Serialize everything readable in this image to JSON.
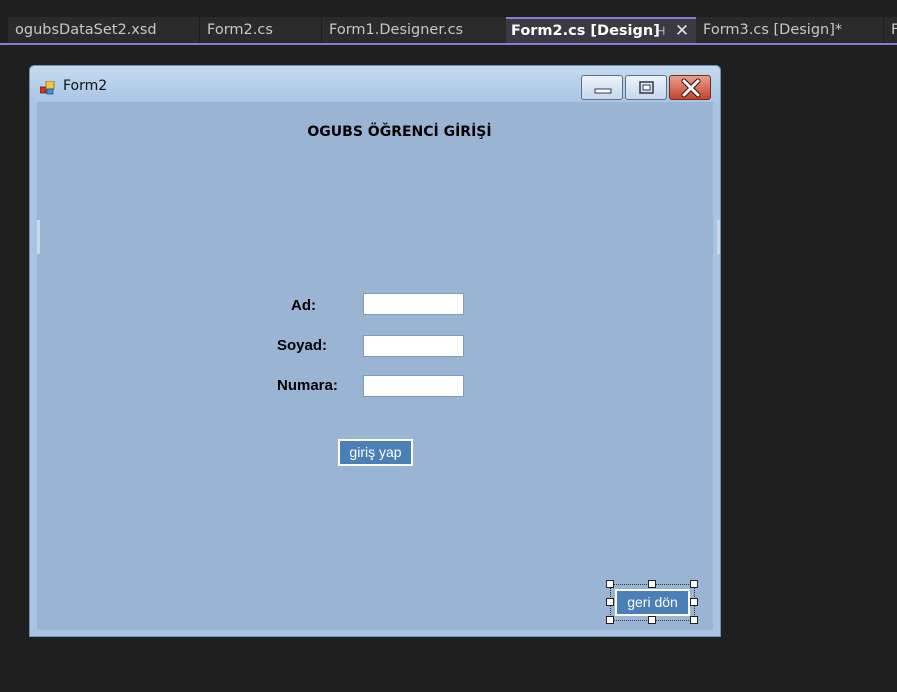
{
  "tabs": [
    {
      "label": "ogubsDataSet2.xsd",
      "active": false
    },
    {
      "label": "Form2.cs",
      "active": false
    },
    {
      "label": "Form1.Designer.cs",
      "active": false
    },
    {
      "label": "Form2.cs [Design]",
      "active": true
    },
    {
      "label": "Form3.cs [Design]*",
      "active": false
    },
    {
      "label": "F",
      "active": false
    }
  ],
  "tab_controls": {
    "pin_glyph": "⊣",
    "close_glyph": "✕"
  },
  "form": {
    "title": "Form2",
    "heading": "OGUBS ÖĞRENCİ GİRİŞİ",
    "fields": [
      {
        "label": "Ad:",
        "value": ""
      },
      {
        "label": "Soyad:",
        "value": ""
      },
      {
        "label": "Numara:",
        "value": ""
      }
    ],
    "login_button": "giriş yap",
    "back_button": "geri dön"
  },
  "colors": {
    "ide_background": "#1f1f1f",
    "tab_accent": "#8a7cd8",
    "form_client": "#9ab4d3",
    "button_fill": "#4a7fb8"
  },
  "icons": [
    "pin-icon",
    "close-icon",
    "app-icon",
    "minimize-icon",
    "maximize-icon",
    "window-close-icon"
  ]
}
